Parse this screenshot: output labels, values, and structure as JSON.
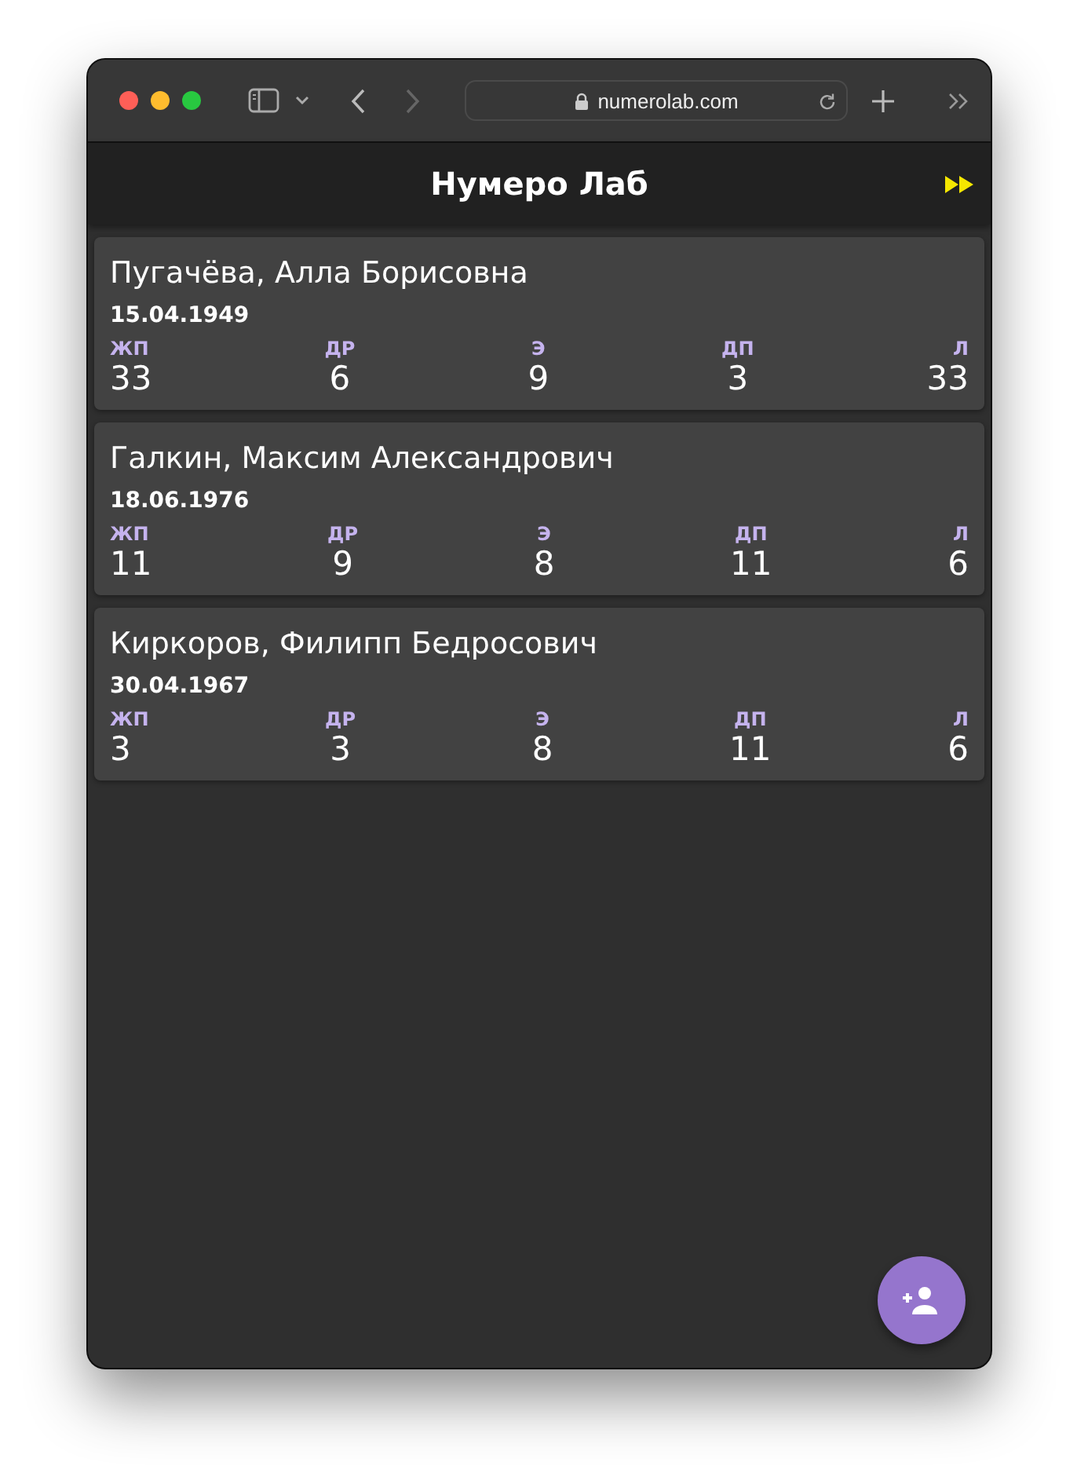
{
  "browser": {
    "url": "numerolab.com"
  },
  "app": {
    "title": "Нумеро Лаб"
  },
  "people": [
    {
      "name": "Пугачёва, Алла Борисовна",
      "date": "15.04.1949",
      "stats": [
        {
          "label": "ЖП",
          "value": "33"
        },
        {
          "label": "ДР",
          "value": "6"
        },
        {
          "label": "Э",
          "value": "9"
        },
        {
          "label": "ДП",
          "value": "3"
        },
        {
          "label": "Л",
          "value": "33"
        }
      ]
    },
    {
      "name": "Галкин, Максим Александрович",
      "date": "18.06.1976",
      "stats": [
        {
          "label": "ЖП",
          "value": "11"
        },
        {
          "label": "ДР",
          "value": "9"
        },
        {
          "label": "Э",
          "value": "8"
        },
        {
          "label": "ДП",
          "value": "11"
        },
        {
          "label": "Л",
          "value": "6"
        }
      ]
    },
    {
      "name": "Киркоров, Филипп Бедросович",
      "date": "30.04.1967",
      "stats": [
        {
          "label": "ЖП",
          "value": "3"
        },
        {
          "label": "ДР",
          "value": "3"
        },
        {
          "label": "Э",
          "value": "8"
        },
        {
          "label": "ДП",
          "value": "11"
        },
        {
          "label": "Л",
          "value": "6"
        }
      ]
    }
  ]
}
